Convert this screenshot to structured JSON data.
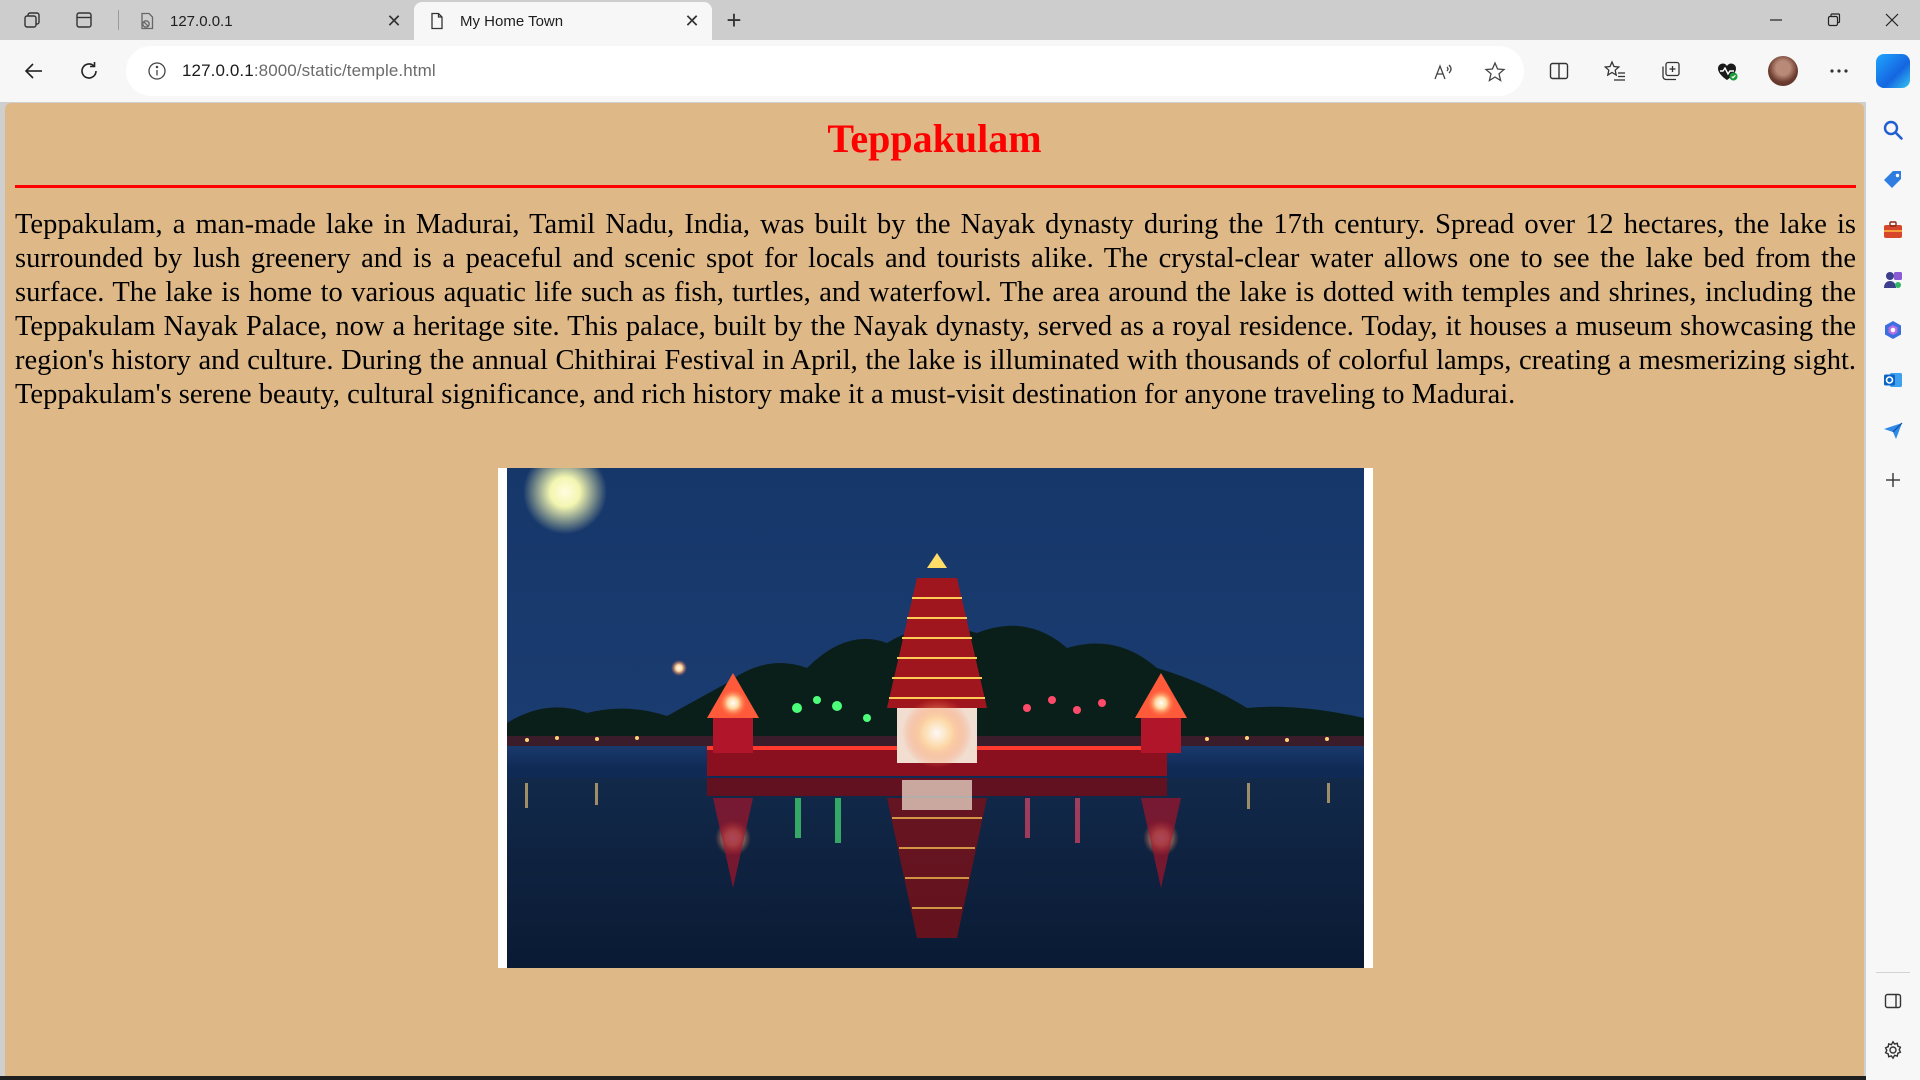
{
  "browser": {
    "tabs": [
      {
        "title": "127.0.0.1",
        "active": false
      },
      {
        "title": "My Home Town",
        "active": true
      }
    ],
    "url": {
      "host": "127.0.0.1",
      "path": ":8000/static/temple.html"
    }
  },
  "page": {
    "title": "Teppakulam",
    "paragraph": "Teppakulam, a man-made lake in Madurai, Tamil Nadu, India, was built by the Nayak dynasty during the 17th century. Spread over 12 hectares, the lake is surrounded by lush greenery and is a peaceful and scenic spot for locals and tourists alike. The crystal-clear water allows one to see the lake bed from the surface. The lake is home to various aquatic life such as fish, turtles, and waterfowl. The area around the lake is dotted with temples and shrines, including the Teppakulam Nayak Palace, now a heritage site. This palace, built by the Nayak dynasty, served as a royal residence. Today, it houses a museum showcasing the region's history and culture. During the annual Chithirai Festival in April, the lake is illuminated with thousands of colorful lamps, creating a mesmerizing sight. Teppakulam's serene beauty, cultural significance, and rich history make it a must-visit destination for anyone traveling to Madurai.",
    "colors": {
      "background": "#deb887",
      "heading": "#ff0000",
      "rule": "#ff0000"
    }
  }
}
